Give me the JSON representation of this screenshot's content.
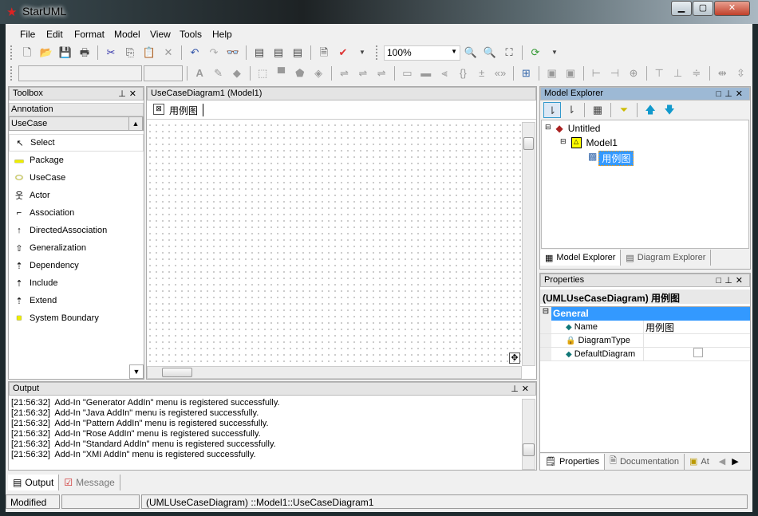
{
  "window": {
    "title": "StarUML",
    "controls": [
      "minimize",
      "maximize",
      "close"
    ]
  },
  "menu": [
    "File",
    "Edit",
    "Format",
    "Model",
    "View",
    "Tools",
    "Help"
  ],
  "toolbar1": {
    "icons": [
      "new-icon",
      "open-icon",
      "save-icon",
      "print-icon",
      "cut-icon",
      "copy-icon",
      "paste-icon",
      "delete-icon",
      "undo-icon",
      "redo-icon",
      "find-icon",
      "diagram-icon",
      "diagram2-icon",
      "diagram3-icon",
      "xmi-icon",
      "verify-icon"
    ],
    "zoom": "100%"
  },
  "toolbox": {
    "title": "Toolbox",
    "groups": [
      "Annotation",
      "UseCase"
    ],
    "items": [
      {
        "label": "Select",
        "icon": "arrow-pointer-icon",
        "glyph": "↖"
      },
      {
        "label": "Package",
        "icon": "package-icon",
        "glyph": "▬"
      },
      {
        "label": "UseCase",
        "icon": "usecase-ellipse-icon",
        "glyph": "⬭"
      },
      {
        "label": "Actor",
        "icon": "actor-icon",
        "glyph": "웃"
      },
      {
        "label": "Association",
        "icon": "association-icon",
        "glyph": "⌐"
      },
      {
        "label": "DirectedAssociation",
        "icon": "directed-association-icon",
        "glyph": "↑"
      },
      {
        "label": "Generalization",
        "icon": "generalization-icon",
        "glyph": "⇧"
      },
      {
        "label": "Dependency",
        "icon": "dependency-icon",
        "glyph": "⇡"
      },
      {
        "label": "Include",
        "icon": "include-icon",
        "glyph": "⇡"
      },
      {
        "label": "Extend",
        "icon": "extend-icon",
        "glyph": "⇡"
      },
      {
        "label": "System Boundary",
        "icon": "system-boundary-icon",
        "glyph": "■"
      }
    ]
  },
  "diagram": {
    "title": "UseCaseDiagram1 (Model1)",
    "tab": "用例图"
  },
  "explorer": {
    "title": "Model Explorer",
    "tree": [
      {
        "label": "Untitled"
      },
      {
        "label": "Model1"
      },
      {
        "label": "用例图"
      }
    ],
    "tabs": [
      "Model Explorer",
      "Diagram Explorer"
    ]
  },
  "properties": {
    "title": "Properties",
    "subject": "(UMLUseCaseDiagram) 用例图",
    "section": "General",
    "rows": [
      {
        "name": "Name",
        "value": "用例图"
      },
      {
        "name": "DiagramType",
        "value": ""
      },
      {
        "name": "DefaultDiagram",
        "value": ""
      }
    ],
    "tabs": [
      "Properties",
      "Documentation",
      "At"
    ]
  },
  "output": {
    "title": "Output",
    "lines": [
      "[21:56:32]  Add-In \"Generator AddIn\" menu is registered successfully.",
      "[21:56:32]  Add-In \"Java AddIn\" menu is registered successfully.",
      "[21:56:32]  Add-In \"Pattern AddIn\" menu is registered successfully.",
      "[21:56:32]  Add-In \"Rose AddIn\" menu is registered successfully.",
      "[21:56:32]  Add-In \"Standard AddIn\" menu is registered successfully.",
      "[21:56:32]  Add-In \"XMI AddIn\" menu is registered successfully."
    ],
    "tabs": [
      "Output",
      "Message"
    ]
  },
  "status": {
    "state": "Modified",
    "empty": "",
    "path": "(UMLUseCaseDiagram) ::Model1::UseCaseDiagram1"
  }
}
